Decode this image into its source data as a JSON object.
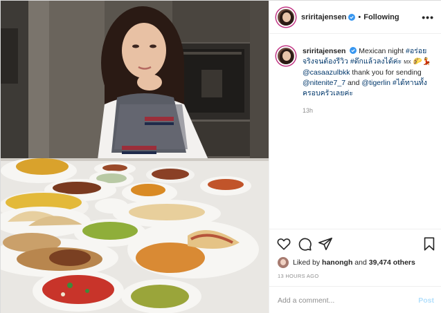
{
  "post": {
    "username": "sriritajensen",
    "follow_status": "Following",
    "more_icon": "more-horizontal-icon"
  },
  "caption": {
    "username": "sriritajensen",
    "text_intro": "Mexican night",
    "hashtag_1": "#อร่อยจริงจนต้องรีวิว",
    "hashtag_2": "#ดึกแล้วลงได้ค่ะ",
    "mx_label": "MX",
    "mention_1": "@casaazulbkk",
    "text_thanks": "thank you for sending",
    "mention_2": "@nitenite7_7",
    "text_and": "and",
    "mention_3": "@tigerlin",
    "hashtag_3": "#ได้ทานทั้งครอบครัวเลยค่ะ",
    "time": "13h"
  },
  "actions": {
    "like_icon": "heart-icon",
    "comment_icon": "comment-icon",
    "share_icon": "share-icon",
    "save_icon": "bookmark-icon"
  },
  "likes": {
    "prefix": "Liked by",
    "first_user": "hanongh",
    "and": "and",
    "others": "39,474 others"
  },
  "timestamp": "13 HOURS AGO",
  "comment": {
    "placeholder": "Add a comment...",
    "post_label": "Post"
  },
  "colors": {
    "link": "#00376b",
    "muted": "#8e8e8e",
    "post_button": "#b2dffc",
    "verified_blue": "#3897f0"
  }
}
